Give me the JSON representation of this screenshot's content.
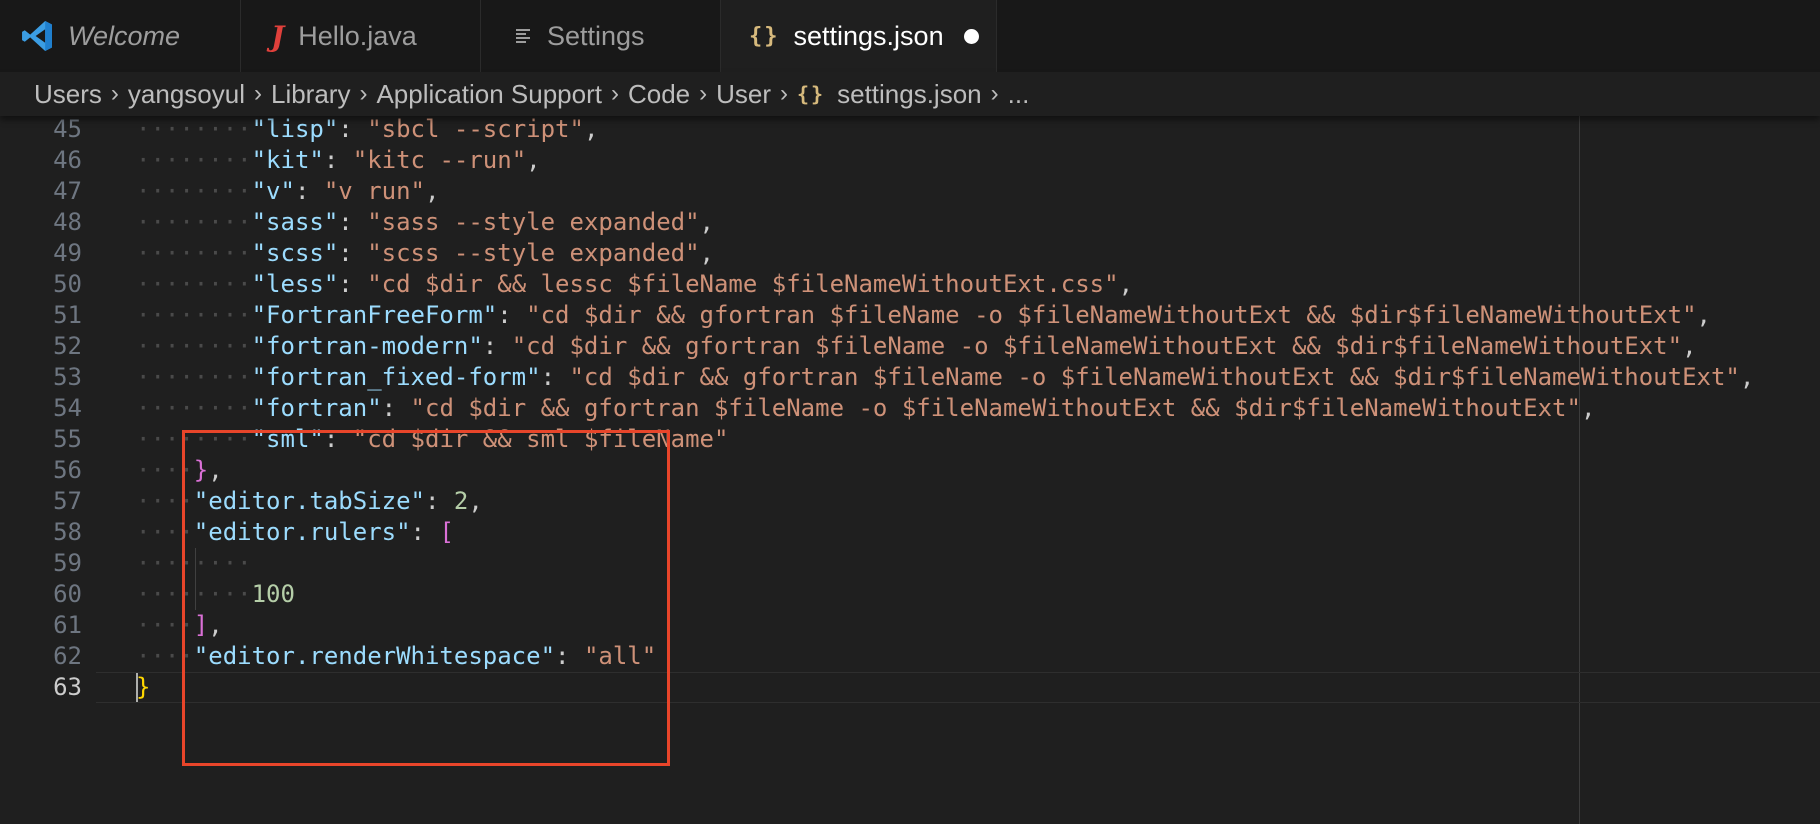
{
  "tabs": [
    {
      "id": "welcome",
      "label": "Welcome",
      "icon": "vscode-logo-icon",
      "italic": true,
      "active": false
    },
    {
      "id": "hello",
      "label": "Hello.java",
      "icon": "java-file-icon",
      "active": false
    },
    {
      "id": "settings-ui",
      "label": "Settings",
      "icon": "settings-list-icon",
      "active": false
    },
    {
      "id": "settings-json",
      "label": "settings.json",
      "icon": "json-braces-icon",
      "active": true,
      "dirty": true
    }
  ],
  "breadcrumb": {
    "items": [
      "Users",
      "yangsoyul",
      "Library",
      "Application Support",
      "Code",
      "User",
      "settings.json",
      "..."
    ]
  },
  "editor": {
    "lines": [
      {
        "n": "45",
        "ws": "········",
        "key": "\"lisp\"",
        "sep": ": ",
        "val": "\"sbcl --script\"",
        "tail": ","
      },
      {
        "n": "46",
        "ws": "········",
        "key": "\"kit\"",
        "sep": ": ",
        "val": "\"kitc --run\"",
        "tail": ","
      },
      {
        "n": "47",
        "ws": "········",
        "key": "\"v\"",
        "sep": ": ",
        "val": "\"v run\"",
        "tail": ","
      },
      {
        "n": "48",
        "ws": "········",
        "key": "\"sass\"",
        "sep": ": ",
        "val": "\"sass --style expanded\"",
        "tail": ","
      },
      {
        "n": "49",
        "ws": "········",
        "key": "\"scss\"",
        "sep": ": ",
        "val": "\"scss --style expanded\"",
        "tail": ","
      },
      {
        "n": "50",
        "ws": "········",
        "key": "\"less\"",
        "sep": ": ",
        "val": "\"cd $dir && lessc $fileName $fileNameWithoutExt.css\"",
        "tail": ","
      },
      {
        "n": "51",
        "ws": "········",
        "key": "\"FortranFreeForm\"",
        "sep": ": ",
        "val": "\"cd $dir && gfortran $fileName -o $fileNameWithoutExt && $dir$fileNameWithoutExt\"",
        "tail": ","
      },
      {
        "n": "52",
        "ws": "········",
        "key": "\"fortran-modern\"",
        "sep": ": ",
        "val": "\"cd $dir && gfortran $fileName -o $fileNameWithoutExt && $dir$fileNameWithoutExt\"",
        "tail": ","
      },
      {
        "n": "53",
        "ws": "········",
        "key": "\"fortran_fixed-form\"",
        "sep": ": ",
        "val": "\"cd $dir && gfortran $fileName -o $fileNameWithoutExt && $dir$fileNameWithoutExt\"",
        "tail": ","
      },
      {
        "n": "54",
        "ws": "········",
        "key": "\"fortran\"",
        "sep": ": ",
        "val": "\"cd $dir && gfortran $fileName -o $fileNameWithoutExt && $dir$fileNameWithoutExt\"",
        "tail": ","
      },
      {
        "n": "55",
        "ws": "········",
        "key": "\"sml\"",
        "sep": ": ",
        "val": "\"cd $dir && sml $fileName\"",
        "tail": ""
      },
      {
        "n": "56",
        "ws": "····",
        "bracket": "}",
        "bracketColor": "mag",
        "tail": ","
      },
      {
        "n": "57",
        "ws": "····",
        "key": "\"editor.tabSize\"",
        "sep": ": ",
        "num": "2",
        "tail": ","
      },
      {
        "n": "58",
        "ws": "····",
        "key": "\"editor.rulers\"",
        "sep": ": ",
        "bracket": "[",
        "bracketColor": "mag",
        "tail": ""
      },
      {
        "n": "59",
        "ws": "········",
        "tail": ""
      },
      {
        "n": "60",
        "ws": "········",
        "num": "100",
        "tail": ""
      },
      {
        "n": "61",
        "ws": "····",
        "bracket": "]",
        "bracketColor": "mag",
        "tail": ","
      },
      {
        "n": "62",
        "ws": "····",
        "key": "\"editor.renderWhitespace\"",
        "sep": ": ",
        "val": "\"all\"",
        "tail": ""
      },
      {
        "n": "63",
        "ws": "",
        "bracket": "}",
        "bracketColor": "gold",
        "tail": "",
        "current": true
      }
    ],
    "ruler_column": 100,
    "colors": {
      "key": "#9cdcfe",
      "string": "#ce9178",
      "number": "#b5cea8",
      "bracket_magenta": "#da70d6",
      "bracket_gold": "#ffd700",
      "highlight_box": "#e8452a"
    }
  }
}
